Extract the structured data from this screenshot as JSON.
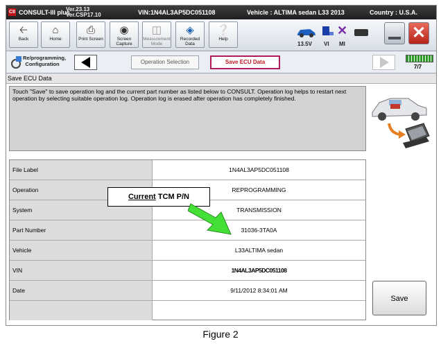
{
  "titlebar": {
    "app": "CONSULT-III plus",
    "ver1": "Ver.23.13",
    "ver2": "Ver.CSP17.10",
    "vin": "VIN:1N4AL3AP5DC051108",
    "vehicle": "Vehicle : ALTIMA sedan L33 2013",
    "country": "Country : U.S.A."
  },
  "toolbar": {
    "buttons": [
      {
        "label": "Back",
        "icon": "back-arrow-icon"
      },
      {
        "label": "Home",
        "icon": "home-icon"
      },
      {
        "label": "Print Screen",
        "icon": "printer-icon"
      },
      {
        "label": "Screen Capture",
        "icon": "camera-icon"
      },
      {
        "label": "Measurement Mode",
        "icon": "measurement-icon"
      },
      {
        "label": "Recorded Data",
        "icon": "recorded-data-icon"
      },
      {
        "label": "Help",
        "icon": "help-icon"
      }
    ],
    "voltage": "13.5V",
    "vi": "VI",
    "mi": "MI"
  },
  "nav": {
    "section": "Re/programming, Configuration",
    "step1": "Operation Selection",
    "step2": "Save ECU Data",
    "page": "7/7"
  },
  "section_header": "Save ECU Data",
  "message": "Touch \"Save\" to save operation log and the current part number as listed below to CONSULT. Operation log helps to restart next operation by selecting suitable operation log. Operation log is erased after operation has completely finished.",
  "table": [
    {
      "label": "File Label",
      "value": "1N4AL3AP5DC051108"
    },
    {
      "label": "Operation",
      "value": "REPROGRAMMING"
    },
    {
      "label": "System",
      "value": "TRANSMISSION"
    },
    {
      "label": "Part Number",
      "value": "31036-3TA0A"
    },
    {
      "label": "Vehicle",
      "value": "L33ALTIMA sedan"
    },
    {
      "label": "VIN",
      "value": "1N4AL3AP5DC051108"
    },
    {
      "label": "Date",
      "value": "9/11/2012 8:34:01 AM"
    },
    {
      "label": "",
      "value": ""
    }
  ],
  "save_label": "Save",
  "callout": {
    "emph": "Current",
    "rest": " TCM P/N"
  },
  "caption": "Figure 2",
  "colors": {
    "accent": "#b11b5c",
    "arrow": "#3fdc2a",
    "status_bar": "#2e9a2e"
  }
}
